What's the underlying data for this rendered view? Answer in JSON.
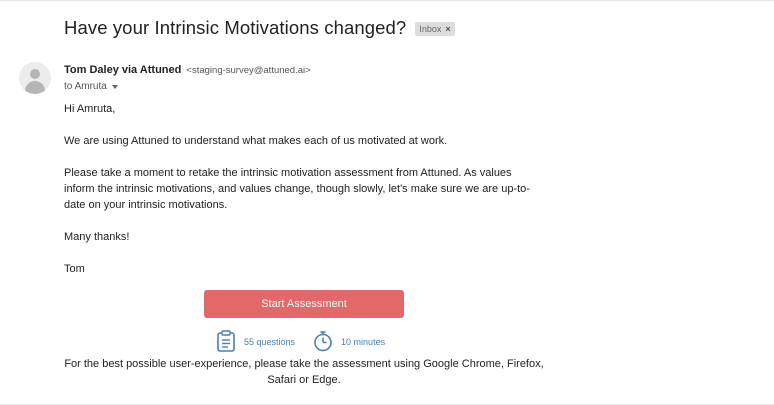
{
  "email": {
    "subject": "Have your Intrinsic Motivations changed?",
    "label": "Inbox",
    "label_close": "×",
    "sender_name": "Tom Daley via Attuned",
    "sender_email": "<staging-survey@attuned.ai>",
    "to": "to Amruta",
    "greeting": "Hi Amruta,",
    "paragraph1": "We are using Attuned to understand what makes each of us motivated at work.",
    "paragraph2": "Please take a moment to retake the intrinsic motivation assessment from Attuned. As values inform the intrinsic motivations, and values change, though slowly, let's make sure we are up-to-date on your intrinsic motivations.",
    "closing": "Many thanks!",
    "signature": "Tom",
    "cta_label": "Start Assessment",
    "questions": "55 questions",
    "duration": "10 minutes",
    "note": "For the best possible user-experience, please take the assessment using Google Chrome, Firefox, Safari or Edge."
  },
  "colors": {
    "cta": "#e2686a",
    "meta": "#4a7fb0"
  },
  "icons": {
    "avatar": "person-silhouette",
    "questions": "clipboard-icon",
    "duration": "stopwatch-icon",
    "label_close": "close-icon",
    "to_caret": "chevron-down-icon"
  }
}
